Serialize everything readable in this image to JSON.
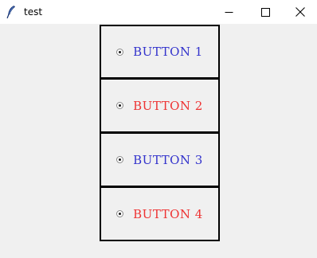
{
  "window": {
    "title": "test",
    "icon": "feather-icon",
    "controls": {
      "minimize": "minimize-icon",
      "maximize": "maximize-icon",
      "close": "close-icon"
    }
  },
  "radio_buttons": [
    {
      "label": "BUTTON 1",
      "color": "#3333cc"
    },
    {
      "label": "BUTTON 2",
      "color": "#ee3333"
    },
    {
      "label": "BUTTON 3",
      "color": "#3333cc"
    },
    {
      "label": "BUTTON 4",
      "color": "#ee3333"
    }
  ],
  "colors": {
    "background": "#f0f0f0",
    "titlebar": "#ffffff",
    "frame_border": "#000000"
  }
}
